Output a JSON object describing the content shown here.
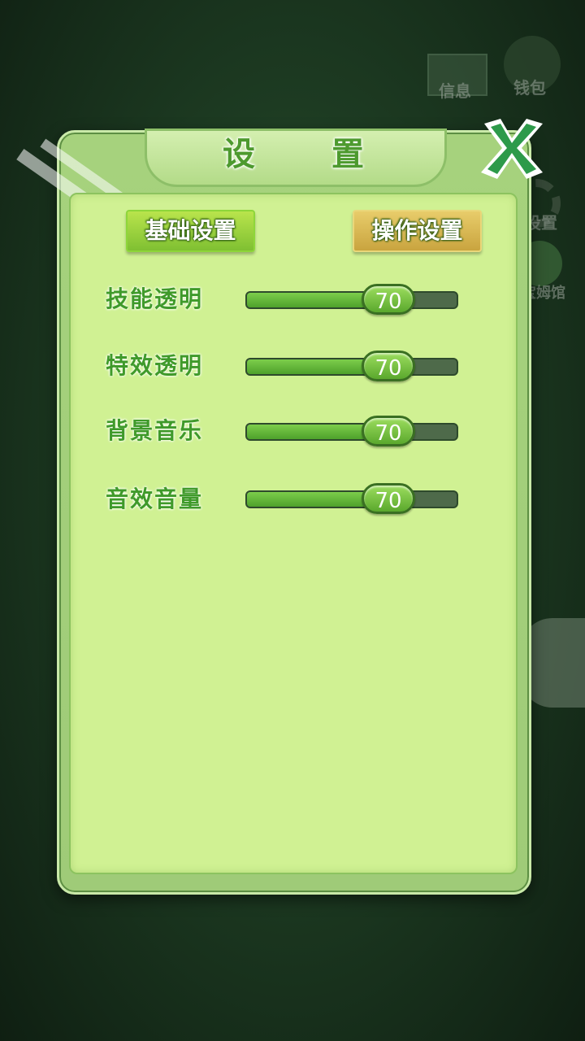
{
  "background_menu": {
    "mail_label": "信息",
    "bag_label": "钱包",
    "settings_label": "设置",
    "slime_label": "宝姆馆"
  },
  "dialog": {
    "title": "设 置",
    "tabs": [
      {
        "label": "基础设置",
        "active": true
      },
      {
        "label": "操作设置",
        "active": false
      }
    ],
    "sliders": [
      {
        "label": "技能透明",
        "value": "70",
        "fraction": 0.7
      },
      {
        "label": "特效透明",
        "value": "70",
        "fraction": 0.7
      },
      {
        "label": "背景音乐",
        "value": "70",
        "fraction": 0.7
      },
      {
        "label": "音效音量",
        "value": "70",
        "fraction": 0.7
      }
    ]
  },
  "icons": {
    "close": "close-icon",
    "gear": "gear-icon",
    "mail": "mail-icon",
    "bag": "bag-icon",
    "slime": "slime-icon"
  },
  "colors": {
    "accent_green": "#4d9a2e",
    "panel_green": "#d0f193",
    "close_white": "#ffffff",
    "close_green": "#2d9a4a"
  }
}
